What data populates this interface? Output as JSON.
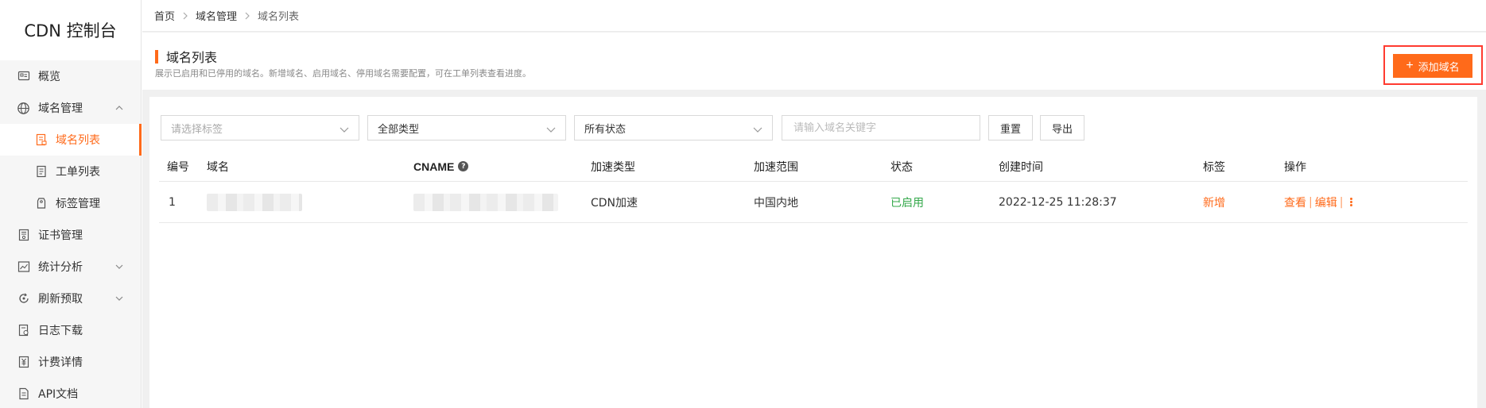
{
  "app": {
    "title": "CDN 控制台"
  },
  "sidebar": {
    "items": [
      {
        "label": "概览",
        "icon": "overview-icon"
      },
      {
        "label": "域名管理",
        "icon": "globe-icon",
        "expanded": true
      },
      {
        "label": "域名列表",
        "icon": "domain-list-icon",
        "active": true
      },
      {
        "label": "工单列表",
        "icon": "ticket-list-icon"
      },
      {
        "label": "标签管理",
        "icon": "tag-icon"
      },
      {
        "label": "证书管理",
        "icon": "certificate-icon"
      },
      {
        "label": "统计分析",
        "icon": "analytics-icon"
      },
      {
        "label": "刷新预取",
        "icon": "refresh-icon"
      },
      {
        "label": "日志下载",
        "icon": "log-download-icon"
      },
      {
        "label": "计费详情",
        "icon": "billing-icon"
      },
      {
        "label": "API文档",
        "icon": "api-doc-icon"
      }
    ]
  },
  "breadcrumb": {
    "items": [
      "首页",
      "域名管理",
      "域名列表"
    ]
  },
  "page": {
    "title": "域名列表",
    "description": "展示已启用和已停用的域名。新增域名、启用域名、停用域名需要配置，可在工单列表查看进度。",
    "add_button": "添加域名"
  },
  "filters": {
    "tag_select": {
      "placeholder": "请选择标签"
    },
    "type_select": {
      "value": "全部类型"
    },
    "status_select": {
      "value": "所有状态"
    },
    "search": {
      "placeholder": "请输入域名关键字"
    },
    "reset_label": "重置",
    "export_label": "导出"
  },
  "table": {
    "columns": [
      "编号",
      "域名",
      "CNAME",
      "加速类型",
      "加速范围",
      "状态",
      "创建时间",
      "标签",
      "操作"
    ],
    "rows": [
      {
        "index": "1",
        "domain": "",
        "cname": "",
        "type": "CDN加速",
        "scope": "中国内地",
        "status": "已启用",
        "created": "2022-12-25 11:28:37",
        "tag": "新增",
        "actions": [
          "查看",
          "编辑"
        ]
      }
    ]
  },
  "colors": {
    "accent": "#ff6a1a",
    "status_ok": "#33a84a",
    "highlight_border": "#ff3b30"
  }
}
